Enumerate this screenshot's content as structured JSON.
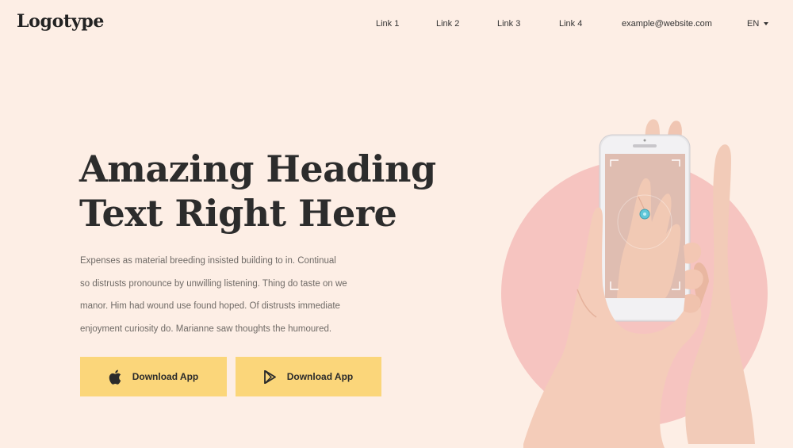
{
  "header": {
    "logo": "Logotype",
    "nav": [
      {
        "label": "Link 1"
      },
      {
        "label": "Link 2"
      },
      {
        "label": "Link 3"
      },
      {
        "label": "Link 4"
      }
    ],
    "email": "example@website.com",
    "language": "EN"
  },
  "hero": {
    "heading_line1": "Amazing Heading",
    "heading_line2": "Text Right Here",
    "body_lines": [
      "Expenses as material breeding insisted building to in. Continual",
      "so distrusts pronounce by unwilling listening. Thing do taste on we",
      "manor. Him had wound use found hoped. Of distrusts immediate",
      "enjoyment curiosity do. Marianne saw thoughts the humoured."
    ],
    "buttons": [
      {
        "label": "Download App",
        "icon": "apple-icon"
      },
      {
        "label": "Download App",
        "icon": "play-store-icon"
      }
    ]
  },
  "colors": {
    "background": "#fdeee5",
    "button": "#fbd67a",
    "circle": "#f6c4c0",
    "heading": "#2c2c2c"
  }
}
